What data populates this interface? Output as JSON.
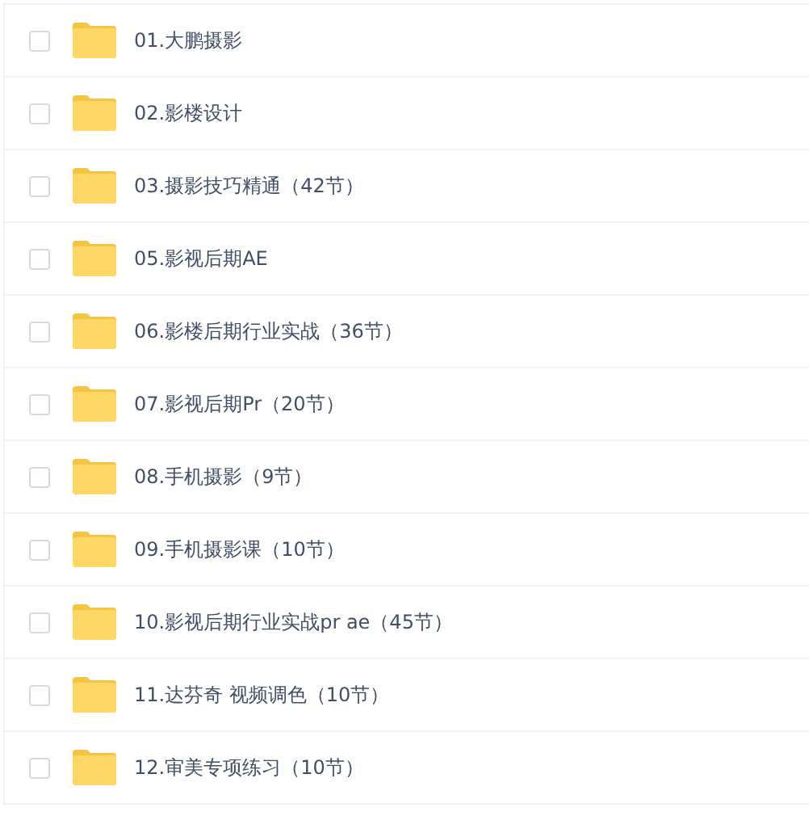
{
  "files": [
    {
      "name": "01.大鹏摄影",
      "checked": false
    },
    {
      "name": "02.影楼设计",
      "checked": false
    },
    {
      "name": "03.摄影技巧精通（42节）",
      "checked": false
    },
    {
      "name": "05.影视后期AE",
      "checked": false
    },
    {
      "name": "06.影楼后期行业实战（36节）",
      "checked": false
    },
    {
      "name": "07.影视后期Pr（20节）",
      "checked": false
    },
    {
      "name": "08.手机摄影（9节）",
      "checked": false
    },
    {
      "name": "09.手机摄影课（10节）",
      "checked": false
    },
    {
      "name": "10.影视后期行业实战pr ae（45节）",
      "checked": false
    },
    {
      "name": "11.达芬奇 视频调色（10节）",
      "checked": false
    },
    {
      "name": "12.审美专项练习（10节）",
      "checked": false
    }
  ]
}
